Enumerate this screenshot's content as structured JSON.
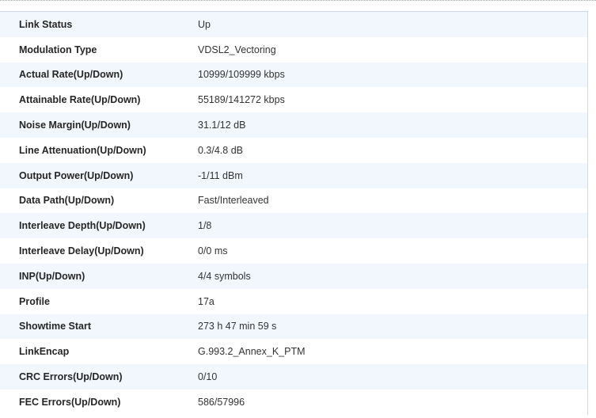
{
  "rows": [
    {
      "label": "Link Status",
      "value": "Up"
    },
    {
      "label": "Modulation Type",
      "value": "VDSL2_Vectoring"
    },
    {
      "label": "Actual Rate(Up/Down)",
      "value": "10999/109999 kbps"
    },
    {
      "label": "Attainable Rate(Up/Down)",
      "value": "55189/141272 kbps"
    },
    {
      "label": "Noise Margin(Up/Down)",
      "value": "31.1/12 dB"
    },
    {
      "label": "Line Attenuation(Up/Down)",
      "value": "0.3/4.8 dB"
    },
    {
      "label": "Output Power(Up/Down)",
      "value": "-1/11 dBm"
    },
    {
      "label": "Data Path(Up/Down)",
      "value": "Fast/Interleaved"
    },
    {
      "label": "Interleave Depth(Up/Down)",
      "value": "1/8"
    },
    {
      "label": "Interleave Delay(Up/Down)",
      "value": "0/0 ms"
    },
    {
      "label": "INP(Up/Down)",
      "value": "4/4 symbols"
    },
    {
      "label": "Profile",
      "value": "17a"
    },
    {
      "label": "Showtime Start",
      "value": "273 h 47 min 59 s"
    },
    {
      "label": "LinkEncap",
      "value": "G.993.2_Annex_K_PTM"
    },
    {
      "label": "CRC Errors(Up/Down)",
      "value": "0/10"
    },
    {
      "label": "FEC Errors(Up/Down)",
      "value": "586/57996"
    }
  ],
  "colors": {
    "row_alt": "#f2f7fd",
    "row": "#ffffff",
    "border": "#cfd8e3"
  }
}
